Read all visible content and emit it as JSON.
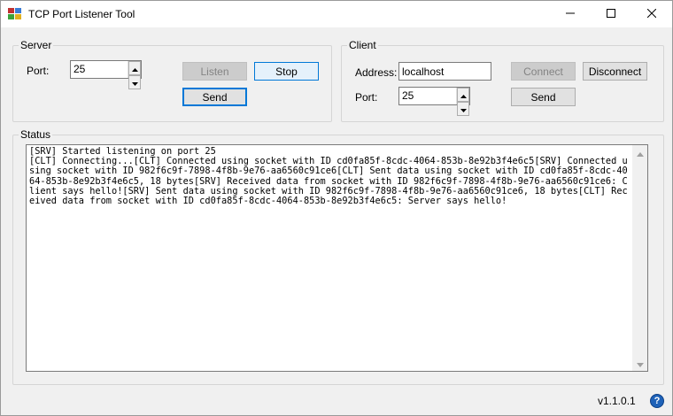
{
  "window": {
    "title": "TCP Port Listener Tool"
  },
  "server": {
    "group_label": "Server",
    "port_label": "Port:",
    "port_value": "25",
    "listen_label": "Listen",
    "stop_label": "Stop",
    "send_label": "Send"
  },
  "client": {
    "group_label": "Client",
    "address_label": "Address:",
    "address_value": "localhost",
    "port_label": "Port:",
    "port_value": "25",
    "connect_label": "Connect",
    "disconnect_label": "Disconnect",
    "send_label": "Send"
  },
  "status": {
    "group_label": "Status",
    "log": "[SRV] Started listening on port 25\n[CLT] Connecting...[CLT] Connected using socket with ID cd0fa85f-8cdc-4064-853b-8e92b3f4e6c5[SRV] Connected using socket with ID 982f6c9f-7898-4f8b-9e76-aa6560c91ce6[CLT] Sent data using socket with ID cd0fa85f-8cdc-4064-853b-8e92b3f4e6c5, 18 bytes[SRV] Received data from socket with ID 982f6c9f-7898-4f8b-9e76-aa6560c91ce6: Client says hello![SRV] Sent data using socket with ID 982f6c9f-7898-4f8b-9e76-aa6560c91ce6, 18 bytes[CLT] Received data from socket with ID cd0fa85f-8cdc-4064-853b-8e92b3f4e6c5: Server says hello!"
  },
  "footer": {
    "version": "v1.1.0.1",
    "help_glyph": "?"
  },
  "icons": {
    "app": "app-icon",
    "minimize": "minimize-icon",
    "maximize": "maximize-icon",
    "close": "close-icon",
    "help": "help-icon"
  },
  "colors": {
    "accent": "#0078d7",
    "help": "#1e62b8"
  }
}
